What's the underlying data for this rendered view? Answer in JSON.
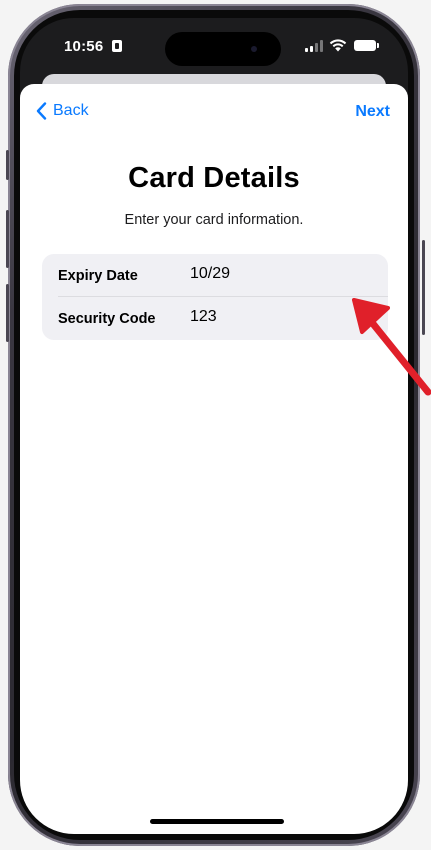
{
  "status_bar": {
    "time": "10:56",
    "icons": [
      "sim-card-icon",
      "cellular-signal-icon",
      "wifi-icon",
      "battery-icon"
    ]
  },
  "nav": {
    "back_label": "Back",
    "next_label": "Next"
  },
  "page": {
    "title": "Card Details",
    "subtitle": "Enter your card information."
  },
  "form": {
    "fields": [
      {
        "label": "Expiry Date",
        "value": "10/29"
      },
      {
        "label": "Security Code",
        "value": "123"
      }
    ]
  },
  "colors": {
    "accent": "#0a7aff",
    "annotation": "#e0202a",
    "field_background": "#f0f0f4"
  }
}
